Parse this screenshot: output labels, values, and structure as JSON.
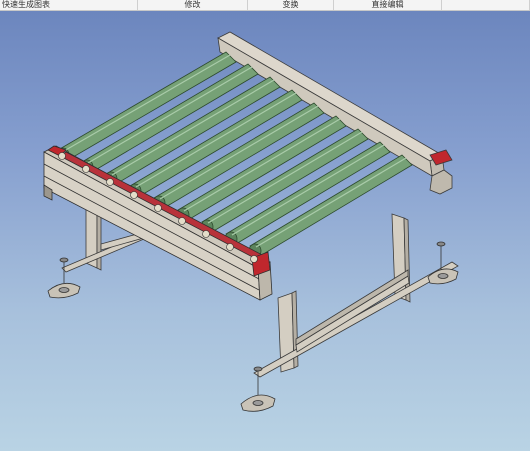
{
  "toolbar": {
    "items": [
      {
        "label": "快速生成图表"
      },
      {
        "label": "修改"
      },
      {
        "label": "变换"
      },
      {
        "label": "直接编辑"
      }
    ]
  },
  "viewport": {
    "background_top": "#6c86be",
    "background_bottom": "#b9d3e4",
    "roller_color": "#6f9a6f",
    "frame_color": "#d6d0c4",
    "accent_color": "#c0272d"
  }
}
